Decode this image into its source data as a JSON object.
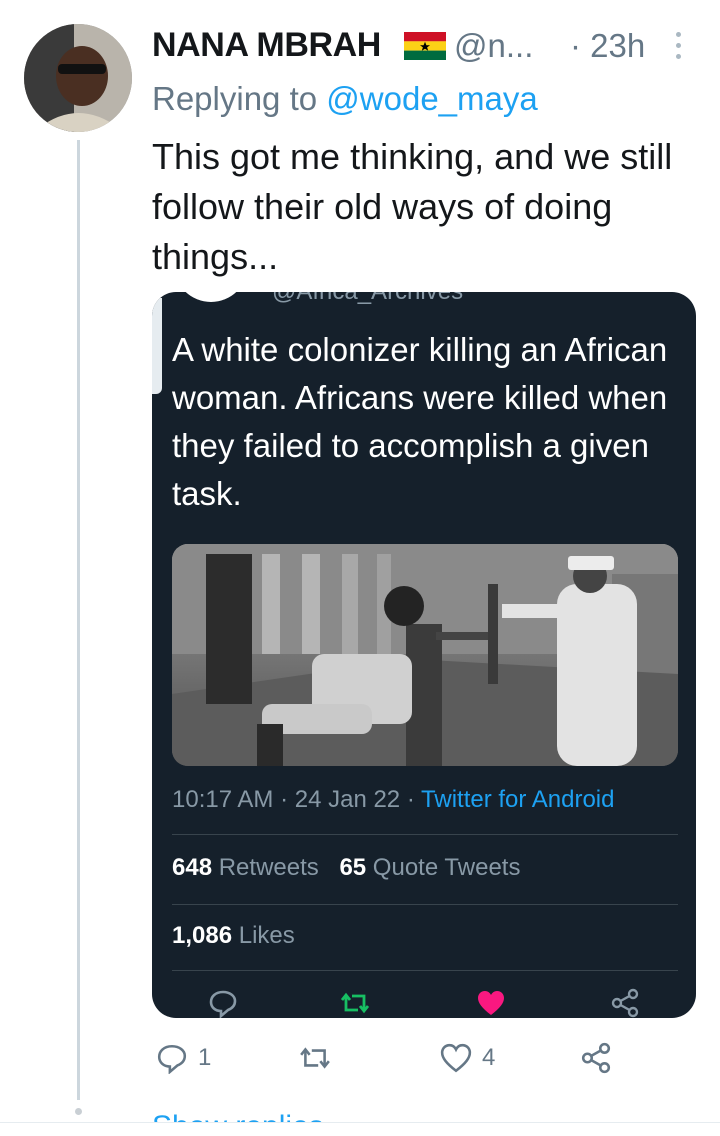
{
  "tweet": {
    "author_name": "NANA MBRAH",
    "author_flag": "ghana-flag-icon",
    "handle": "@n...",
    "time": "· 23h",
    "replying_prefix": "Replying to",
    "replying_mention": "@wode_maya",
    "text": "This got me thinking, and we still follow their old ways of doing things...",
    "replies_count": "1",
    "retweets_count": "",
    "likes_count": "4"
  },
  "quote": {
    "cut_handle": "@Africa_Archives",
    "text": "A white colonizer killing an African woman. Africans were killed when they failed to accomplish a given task.",
    "timestamp": "10:17 AM · 24 Jan 22 · ",
    "source": "Twitter for Android",
    "retweets_value": "648",
    "retweets_label": " Retweets",
    "quote_tweets_value": "65",
    "quote_tweets_label": " Quote Tweets",
    "likes_value": "1,086",
    "likes_label": " Likes"
  },
  "footer": {
    "show_replies": "Show replies"
  },
  "colors": {
    "accent": "#1da1f2",
    "card_bg": "#15202b",
    "like_pink": "#f91880",
    "retweet_green": "#17bf63",
    "muted": "#657786"
  }
}
